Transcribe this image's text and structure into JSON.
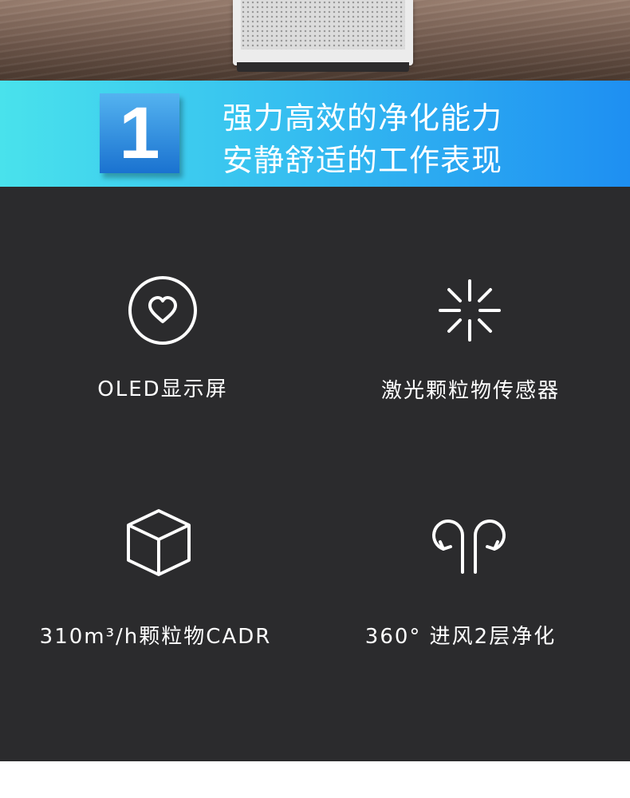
{
  "banner": {
    "number": "1",
    "line1": "强力高效的净化能力",
    "line2": "安静舒适的工作表现"
  },
  "features": [
    {
      "label": "OLED显示屏",
      "icon": "heart-circle-icon"
    },
    {
      "label": "激光颗粒物传感器",
      "icon": "burst-icon"
    },
    {
      "label": "310m³/h颗粒物CADR",
      "icon": "cube-icon"
    },
    {
      "label": "360° 进风2层净化",
      "icon": "airflow-icon"
    }
  ],
  "colors": {
    "banner_gradient_start": "#49e2ec",
    "banner_gradient_end": "#1e8ff2",
    "panel_background": "#2b2b2d",
    "text": "#ffffff"
  }
}
